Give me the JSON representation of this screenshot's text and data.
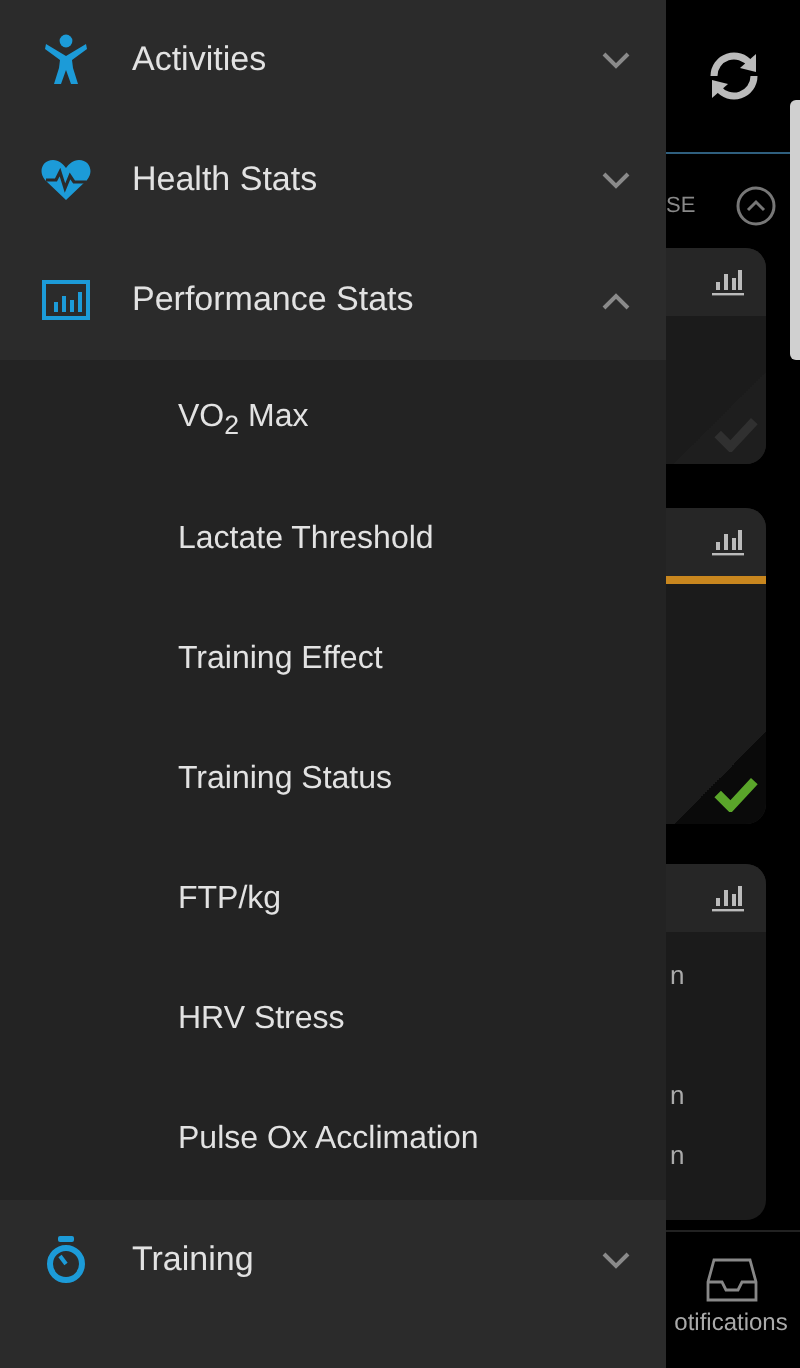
{
  "drawer": {
    "sections": [
      {
        "label": "Activities",
        "expanded": false
      },
      {
        "label": "Health Stats",
        "expanded": false
      },
      {
        "label": "Performance Stats",
        "expanded": true,
        "children": [
          {
            "label": "VO$_{2}$ Max"
          },
          {
            "label": "Lactate Threshold"
          },
          {
            "label": "Training Effect"
          },
          {
            "label": "Training Status"
          },
          {
            "label": "FTP/kg"
          },
          {
            "label": "HRV Stress"
          },
          {
            "label": "Pulse Ox Acclimation"
          }
        ]
      },
      {
        "label": "Training",
        "expanded": false
      }
    ]
  },
  "background": {
    "header_text": "SE",
    "cards": [
      {
        "kind": "check",
        "checked": false,
        "highlighted": false
      },
      {
        "kind": "check",
        "checked": true,
        "highlighted": true
      },
      {
        "kind": "list",
        "lines": [
          "n",
          "n",
          "n"
        ]
      }
    ],
    "nav_label": "otifications"
  }
}
